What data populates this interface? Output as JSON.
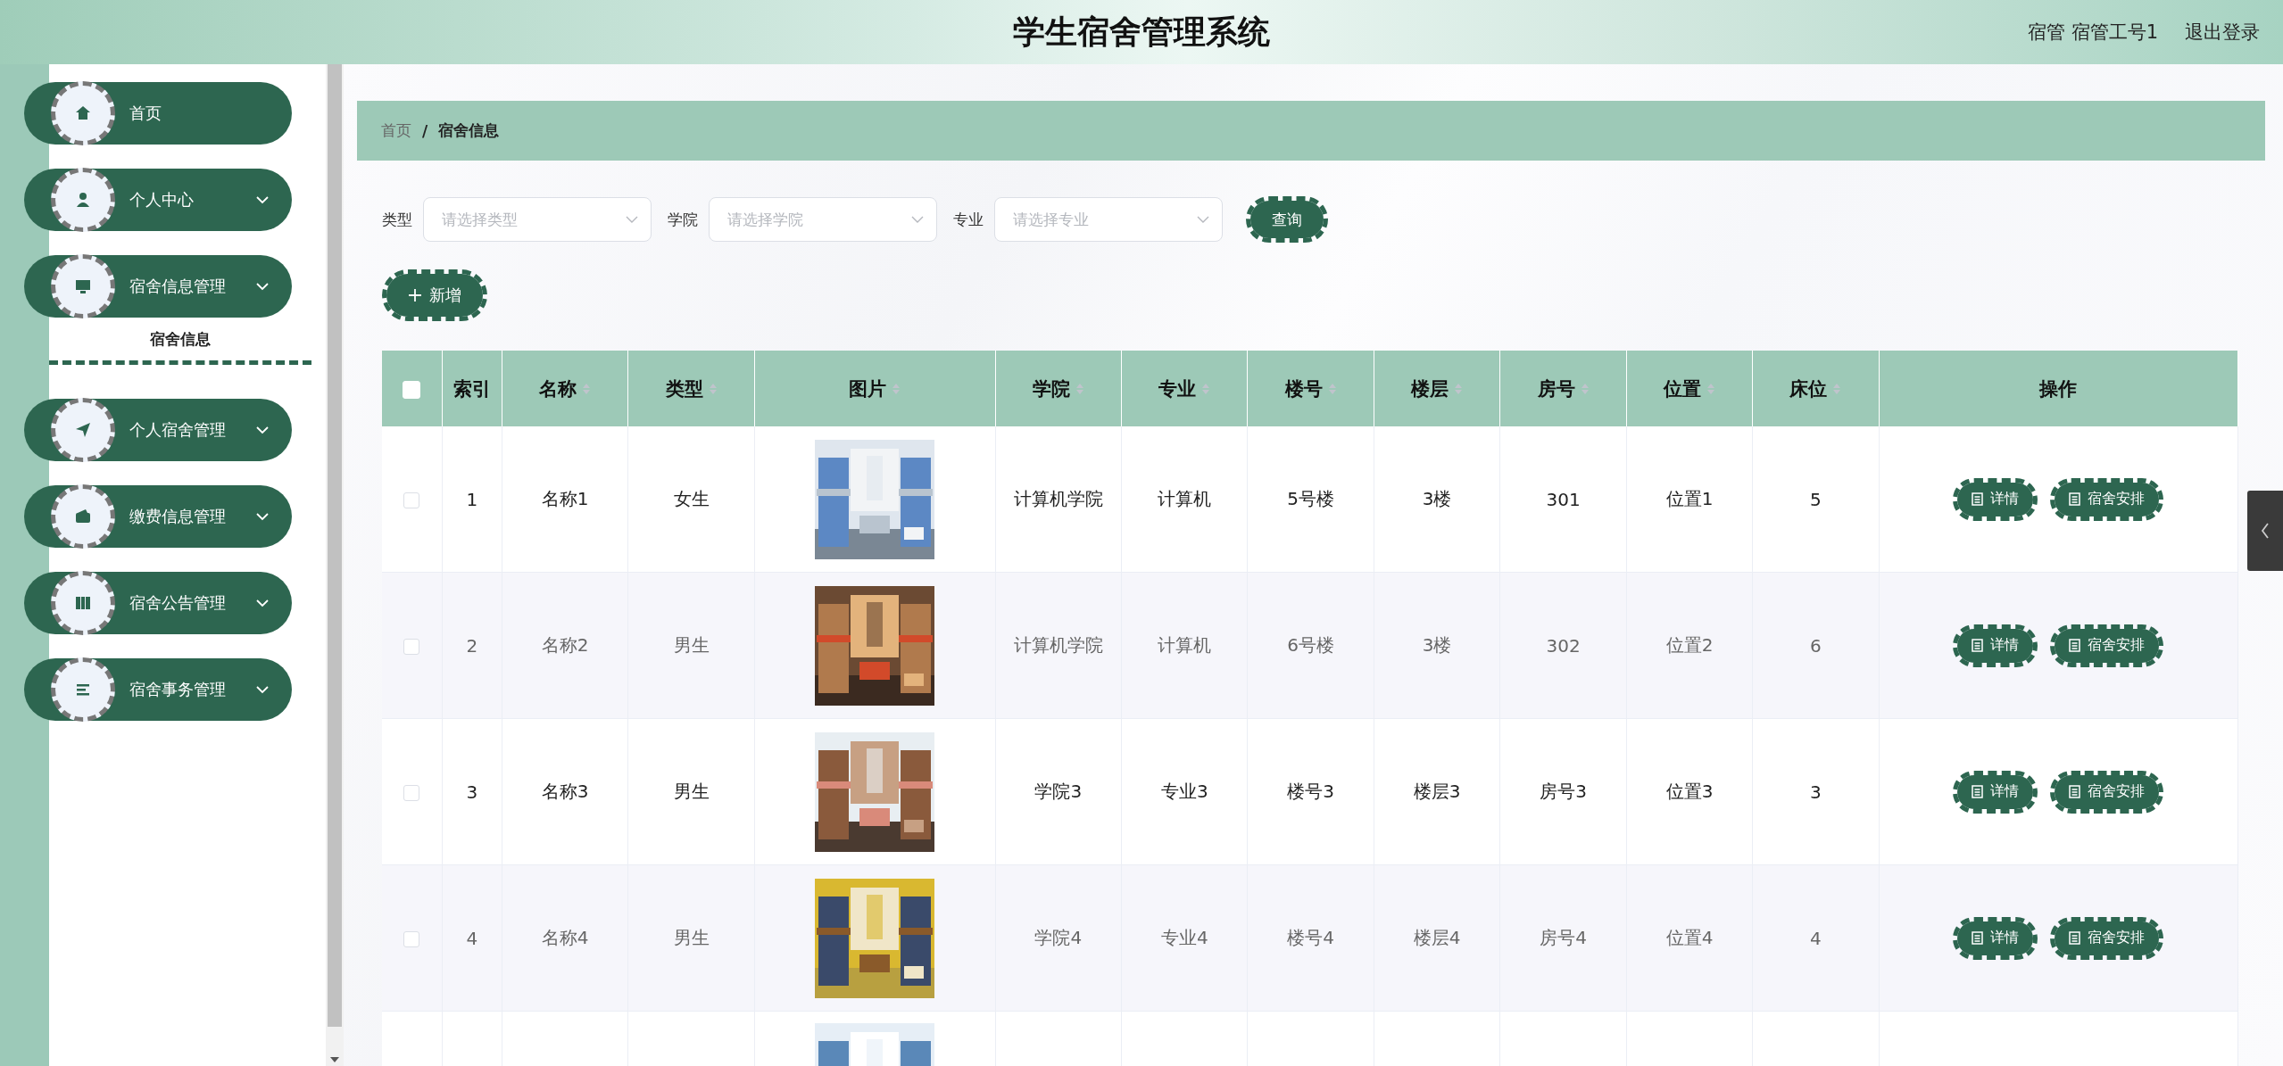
{
  "header": {
    "title": "学生宿舍管理系统",
    "user": "宿管 宿管工号1",
    "logout": "退出登录"
  },
  "sidebar": {
    "items": [
      {
        "label": "首页",
        "kind": "link"
      },
      {
        "label": "个人中心",
        "kind": "submenu"
      },
      {
        "label": "宿舍信息管理",
        "kind": "submenu",
        "children": [
          {
            "label": "宿舍信息",
            "selected": true
          }
        ]
      },
      {
        "label": "个人宿舍管理",
        "kind": "submenu"
      },
      {
        "label": "缴费信息管理",
        "kind": "submenu"
      },
      {
        "label": "宿舍公告管理",
        "kind": "submenu"
      },
      {
        "label": "宿舍事务管理",
        "kind": "submenu"
      }
    ]
  },
  "breadcrumb": {
    "separator": "/",
    "items": [
      {
        "label": "首页",
        "current": false
      },
      {
        "label": "宿舍信息",
        "current": true
      }
    ]
  },
  "filters": [
    {
      "label": "类型",
      "placeholder": "请选择类型"
    },
    {
      "label": "学院",
      "placeholder": "请选择学院"
    },
    {
      "label": "专业",
      "placeholder": "请选择专业"
    }
  ],
  "search_button": "查询",
  "add_button": "新增",
  "table": {
    "select_all_checked": false,
    "columns": [
      {
        "label": "索引",
        "kind": "text",
        "sortable": false
      },
      {
        "label": "名称",
        "kind": "text",
        "sortable": true
      },
      {
        "label": "类型",
        "kind": "text",
        "sortable": true
      },
      {
        "label": "图片",
        "sortable": true
      },
      {
        "label": "学院",
        "kind": "text",
        "sortable": true
      },
      {
        "label": "专业",
        "kind": "text",
        "sortable": true
      },
      {
        "label": "楼号",
        "kind": "text",
        "sortable": true
      },
      {
        "label": "楼层",
        "kind": "text",
        "sortable": true
      },
      {
        "label": "房号",
        "kind": "text",
        "sortable": true
      },
      {
        "label": "位置",
        "kind": "text",
        "sortable": true
      },
      {
        "label": "床位",
        "kind": "text",
        "sortable": true
      },
      {
        "label": "操作",
        "kind": "actions",
        "sortable": false
      }
    ],
    "rows": [
      {
        "checked": false,
        "cells": [
          "1",
          "名称1",
          "女生",
          {
            "kind": "picture"
          },
          "计算机学院",
          "计算机",
          "5号楼",
          "3楼",
          "301",
          "位置1",
          "5"
        ],
        "actions": [
          "详情",
          "宿舍安排"
        ]
      },
      {
        "checked": false,
        "cells": [
          "2",
          "名称2",
          "男生",
          {
            "kind": "picture"
          },
          "计算机学院",
          "计算机",
          "6号楼",
          "3楼",
          "302",
          "位置2",
          "6"
        ],
        "actions": [
          "详情",
          "宿舍安排"
        ]
      },
      {
        "checked": false,
        "cells": [
          "3",
          "名称3",
          "男生",
          {
            "kind": "picture"
          },
          "学院3",
          "专业3",
          "楼号3",
          "楼层3",
          "房号3",
          "位置3",
          "3"
        ],
        "actions": [
          "详情",
          "宿舍安排"
        ]
      },
      {
        "checked": false,
        "cells": [
          "4",
          "名称4",
          "男生",
          {
            "kind": "picture"
          },
          "学院4",
          "专业4",
          "楼号4",
          "楼层4",
          "房号4",
          "位置4",
          "4"
        ],
        "actions": [
          "详情",
          "宿舍安排"
        ]
      }
    ],
    "cut_row": {
      "image": {
        "kind": "picture"
      }
    }
  }
}
